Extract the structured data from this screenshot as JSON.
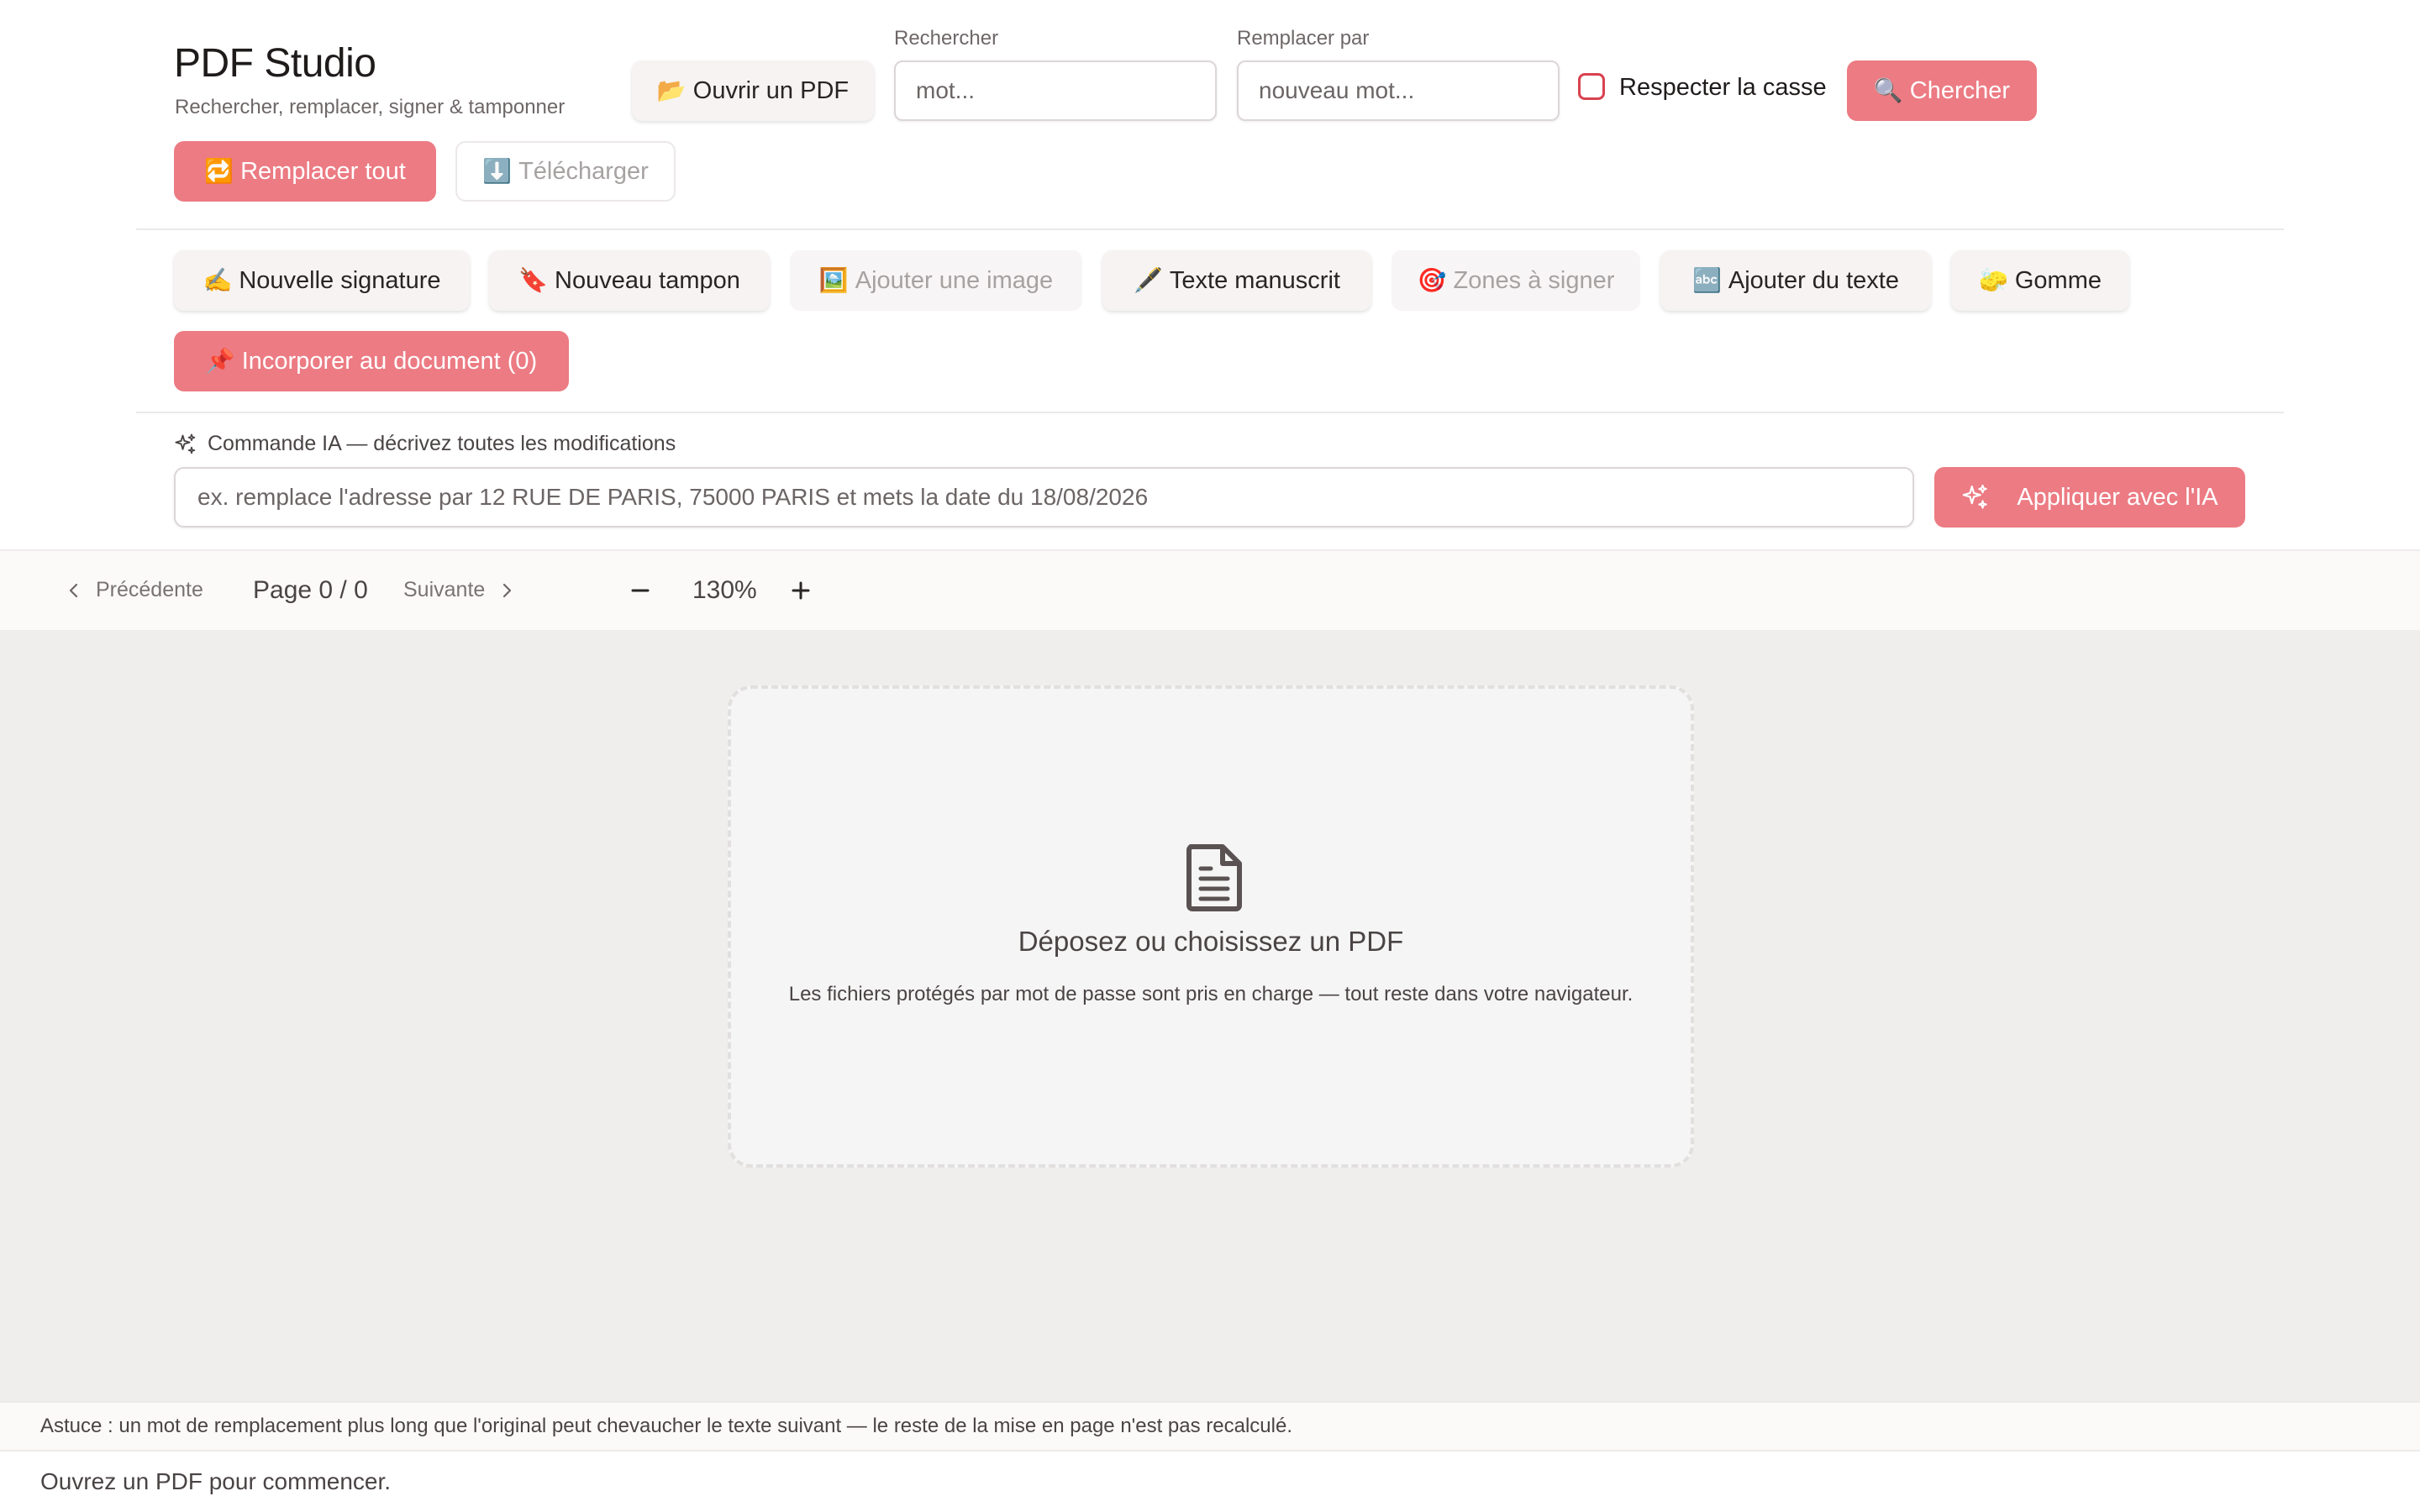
{
  "app": {
    "title": "PDF Studio",
    "subtitle": "Rechercher, remplacer, signer & tamponner"
  },
  "toolbar": {
    "open_label": "Ouvrir un PDF",
    "open_emoji": "📂",
    "search_label": "Rechercher",
    "search_placeholder": "mot...",
    "replace_label": "Remplacer par",
    "replace_placeholder": "nouveau mot...",
    "match_case_label": "Respecter la casse",
    "match_case_checked": false,
    "search_button": "Chercher",
    "search_emoji": "🔍",
    "replace_all": "Remplacer tout",
    "replace_all_emoji": "🔁",
    "download": "Télécharger",
    "download_emoji": "⬇️"
  },
  "tools": {
    "new_signature": "Nouvelle signature",
    "new_signature_emoji": "✍️",
    "new_stamp": "Nouveau tampon",
    "new_stamp_emoji": "🔖",
    "add_image": "Ajouter une image",
    "add_image_emoji": "🖼️",
    "handwritten_text": "Texte manuscrit",
    "handwritten_text_emoji": "🖋️",
    "sign_zones": "Zones à signer",
    "sign_zones_emoji": "🎯",
    "add_text": "Ajouter du texte",
    "add_text_emoji": "🔤",
    "eraser": "Gomme",
    "eraser_emoji": "🧽",
    "embed": "Incorporer au document (0)",
    "embed_emoji": "📌"
  },
  "ai": {
    "label": "Commande IA — décrivez toutes les modifications",
    "placeholder": "ex. remplace l'adresse par 12 RUE DE PARIS, 75000 PARIS et mets la date du 18/08/2026",
    "apply_button": "Appliquer avec l'IA"
  },
  "nav": {
    "previous": "Précédente",
    "page_indicator": "Page 0 / 0",
    "next": "Suivante",
    "zoom": "130%"
  },
  "dropzone": {
    "title": "Déposez ou choisissez un PDF",
    "subtitle": "Les fichiers protégés par mot de passe sont pris en charge — tout reste dans votre navigateur."
  },
  "tip": "Astuce : un mot de remplacement plus long que l'original peut chevaucher le texte suivant — le reste de la mise en page n'est pas recalculé.",
  "status": "Ouvrez un PDF pour commencer.",
  "colors": {
    "primary": "#ec7b83",
    "checkbox_border": "#d9414f",
    "canvas_bg": "#efeeec"
  }
}
